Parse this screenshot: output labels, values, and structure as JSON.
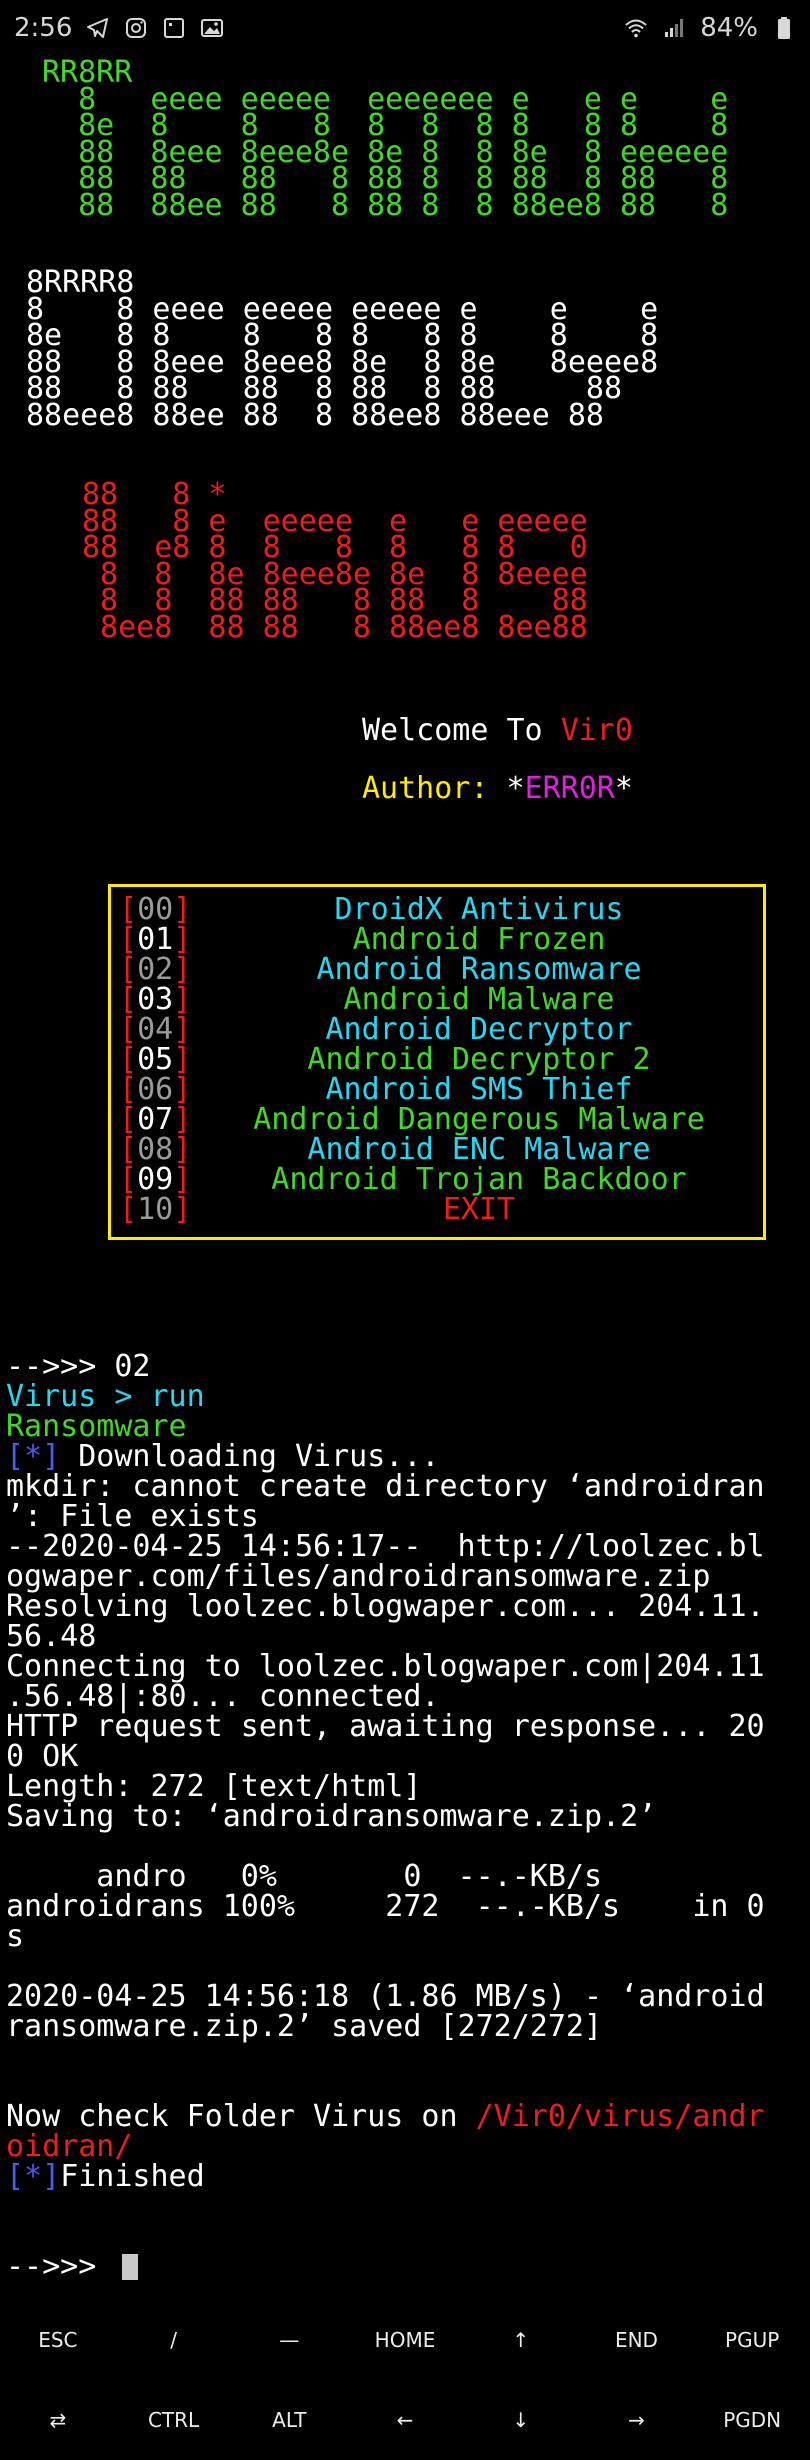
{
  "status_bar": {
    "time": "2:56",
    "battery": "84%",
    "icons_left": [
      "telegram-icon",
      "instagram-icon",
      "notification-icon",
      "gallery-icon"
    ],
    "icons_right": [
      "wifi-icon",
      "signal-icon",
      "battery-icon"
    ]
  },
  "banner": {
    "block1": [
      "RR8RR",
      "  8   eeee eeeee  eeeeeee e   e e    e",
      "  8e  8    8   8  8  8  8 8   8 8    8",
      "  88  8eee 8eee8e 8e 8  8 8e  8 eeeeee",
      "  88  88   88   8 88 8  8 88  8 88   8",
      "  88  88ee 88   8 88 8  8 88ee8 88   8"
    ],
    "block2": [
      "8RRRR8",
      "8    8 eeee eeeee eeeee e    e    e",
      "8e   8 8    8   8 8   8 8    8    8",
      "88   8 8eee 8eee8 8e  8 8e   8eeee8",
      "88   8 88   88  8 88  8 88     88",
      "88eee8 88ee 88  8 88ee8 88eee 88"
    ],
    "block3": [
      "88   8 *",
      "88   8 e  eeeee  e   e eeeee",
      "88  e8 8  8   8  8   8 8   0",
      " 8  8  8e 8eee8e 8e  8 8eeee",
      " 8  8  88 88   8 88  8    88",
      " 8ee8  88 88   8 88ee8 8ee88"
    ]
  },
  "welcome": {
    "prefix": "Welcome To ",
    "name": "Vir0"
  },
  "author": {
    "prefix": "Author: ",
    "star1": "*",
    "name": "ERR0R",
    "star2": "*"
  },
  "menu": {
    "items": [
      {
        "index": "00",
        "label": "DroidX Antivirus"
      },
      {
        "index": "01",
        "label": "Android Frozen"
      },
      {
        "index": "02",
        "label": "Android Ransomware"
      },
      {
        "index": "03",
        "label": "Android Malware"
      },
      {
        "index": "04",
        "label": "Android Decryptor"
      },
      {
        "index": "05",
        "label": "Android Decryptor 2"
      },
      {
        "index": "06",
        "label": "Android SMS Thief"
      },
      {
        "index": "07",
        "label": "Android Dangerous Malware"
      },
      {
        "index": "08",
        "label": "Android ENC Malware"
      },
      {
        "index": "09",
        "label": "Android Trojan Backdoor"
      },
      {
        "index": "10",
        "label": "EXIT"
      }
    ]
  },
  "output": {
    "prompt1": "-->>> 02",
    "virus_run": "Virus > run",
    "ransomware": "Ransomware",
    "downloading_tag": "[*]",
    "downloading": " Downloading Virus...",
    "lines": [
      "mkdir: cannot create directory ‘androidran",
      "’: File exists",
      "--2020-04-25 14:56:17--  http://loolzec.bl",
      "ogwaper.com/files/androidransomware.zip",
      "Resolving loolzec.blogwaper.com... 204.11.",
      "56.48",
      "Connecting to loolzec.blogwaper.com|204.11",
      ".56.48|:80... connected.",
      "HTTP request sent, awaiting response... 20",
      "0 OK",
      "Length: 272 [text/html]",
      "Saving to: ‘androidransomware.zip.2’",
      "",
      "     andro   0%       0  --.-KB/s",
      "androidrans 100%     272  --.-KB/s    in 0",
      "s",
      "",
      "2020-04-25 14:56:18 (1.86 MB/s) - ‘android",
      "ransomware.zip.2’ saved [272/272]"
    ],
    "check_prefix": "Now check Folder Virus on ",
    "check_path_1": "/Vir0/virus/andr",
    "check_path_2": "oidran/",
    "finished_tag": "[*]",
    "finished": "Finished",
    "prompt2": "-->>> "
  },
  "extra_keys": {
    "row1": [
      "ESC",
      "/",
      "—",
      "HOME",
      "↑",
      "END",
      "PGUP"
    ],
    "row2": [
      "⇄",
      "CTRL",
      "ALT",
      "←",
      "↓",
      "→",
      "PGDN"
    ]
  }
}
